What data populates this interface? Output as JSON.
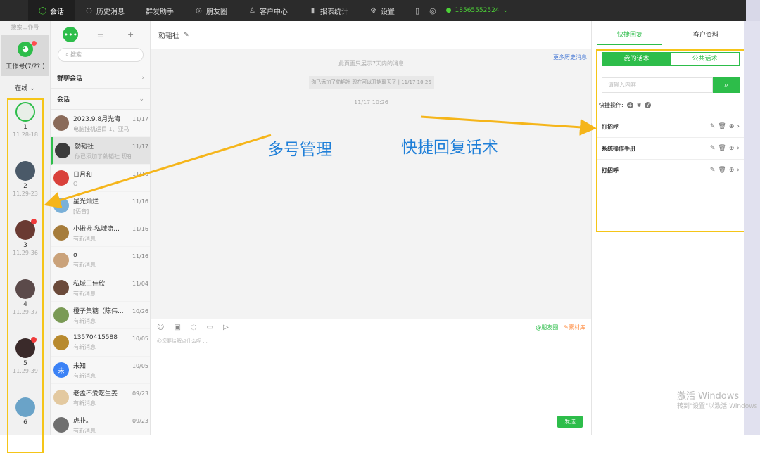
{
  "topbar": {
    "nav": [
      {
        "icon": "chat-icon",
        "label": "会话",
        "active": true
      },
      {
        "icon": "clock-icon",
        "label": "历史消息",
        "active": false
      },
      {
        "icon": "",
        "label": "群发助手",
        "active": false
      },
      {
        "icon": "moments-icon",
        "label": "朋友圈",
        "active": false
      },
      {
        "icon": "person-icon",
        "label": "客户中心",
        "active": false
      },
      {
        "icon": "bar-chart-icon",
        "label": "报表统计",
        "active": false
      },
      {
        "icon": "gear-icon",
        "label": "设置",
        "active": false
      }
    ],
    "user": "18565552524"
  },
  "accounts": {
    "search_placeholder": "搜索工作号",
    "wechat_label": "工作号(7/?? )",
    "status": "在线",
    "items": [
      {
        "num": "1",
        "date": "11.28-18"
      },
      {
        "num": "2",
        "date": "11.29-23"
      },
      {
        "num": "3",
        "date": "11.29-36"
      },
      {
        "num": "4",
        "date": "11.29-37"
      },
      {
        "num": "5",
        "date": "11.29-39"
      },
      {
        "num": "6",
        "date": ""
      }
    ]
  },
  "conversations": {
    "search_placeholder": "搜索",
    "group_section": "群聊会话",
    "chat_section": "会话",
    "items": [
      {
        "name": "2023.9.8月光海",
        "msg": "电脑挂机运目 1、亚马逊社...",
        "time": "11/17",
        "color": "#8a6b5a"
      },
      {
        "name": "勍韬社",
        "msg": "你已添加了勍韬社 现在可...",
        "time": "11/17",
        "color": "#3b3b3b",
        "selected": true
      },
      {
        "name": "日月和",
        "msg": "O",
        "time": "11/16",
        "color": "#d9413b"
      },
      {
        "name": "星光灿烂",
        "msg": "[语音]",
        "time": "11/16",
        "color": "#7ab0d8"
      },
      {
        "name": "小揪揪-私域流...",
        "msg": "有新消息",
        "time": "11/16",
        "color": "#a67c3b"
      },
      {
        "name": "ơ",
        "msg": "有新消息",
        "time": "11/16",
        "color": "#caa27a"
      },
      {
        "name": "私域王佳欣",
        "msg": "有新消息",
        "time": "11/04",
        "color": "#6b4a3a"
      },
      {
        "name": "橙子集糖（陈伟...",
        "msg": "有新消息",
        "time": "10/26",
        "color": "#7a9a55"
      },
      {
        "name": "13570415588",
        "msg": "有新消息",
        "time": "10/05",
        "color": "#b88a2e"
      },
      {
        "name": "未知",
        "msg": "有新消息",
        "time": "10/05",
        "color": "#3b82f6",
        "initial": "未"
      },
      {
        "name": "老孟不爱吃生姜",
        "msg": "有新消息",
        "time": "09/23",
        "color": "#e3c9a0"
      },
      {
        "name": "虎扑。",
        "msg": "有新消息",
        "time": "09/23",
        "color": "#6f6f6f"
      }
    ]
  },
  "chat": {
    "title": "勍韬社",
    "more_history": "更多历史消息",
    "notice": "此页面只展示7天内的消息",
    "system_msg": "你已添加了勍韬社 现在可以开始聊天了 | 11/17 10:26",
    "time": "11/17 10:26",
    "moments_btn": "@朋友圈",
    "material_btn": "✎素材库",
    "input_placeholder": "@您要给解点什么呢 ...",
    "send": "发送"
  },
  "right": {
    "tabs": [
      "快捷回复",
      "客户资料"
    ],
    "seg": [
      "我的话术",
      "公共话术"
    ],
    "search_placeholder": "请输入内容",
    "ops_label": "快捷操作:",
    "items": [
      "打招呼",
      "系统操作手册",
      "打招呼"
    ]
  },
  "annotations": {
    "multi_account": "多号管理",
    "quick_reply": "快捷回复话术"
  },
  "watermark": {
    "title": "激活 Windows",
    "sub": "转到\"设置\"以激活 Windows"
  },
  "colors": {
    "accent": "#2dbd4a",
    "highlight": "#f5c518",
    "annotation": "#1f7fd8"
  }
}
